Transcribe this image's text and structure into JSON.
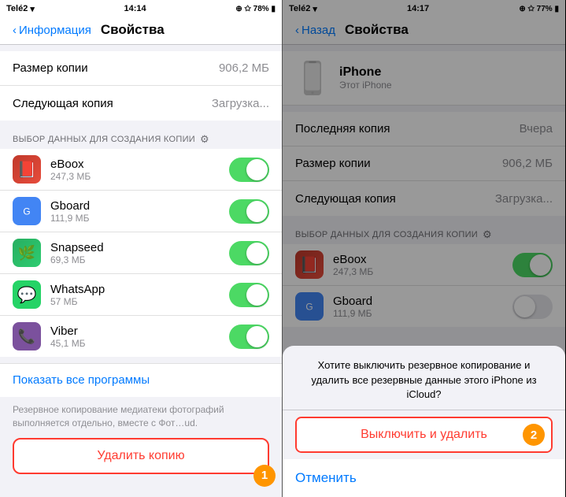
{
  "left_screen": {
    "status_bar": {
      "carrier": "Telé2",
      "time": "14:14",
      "icons_right": "⊕ ☆ 78%"
    },
    "nav": {
      "back_label": "Информация",
      "title": "Свойства"
    },
    "rows": [
      {
        "label": "Размер копии",
        "value": "906,2 МБ"
      },
      {
        "label": "Следующая копия",
        "value": "Загрузка..."
      }
    ],
    "section_header": "ВЫБОР ДАННЫХ ДЛЯ СОЗДАНИЯ КОПИИ",
    "apps": [
      {
        "name": "eBoox",
        "size": "247,3 МБ",
        "icon_type": "ebook",
        "toggle": "on"
      },
      {
        "name": "Gboard",
        "size": "111,9 МБ",
        "icon_type": "gboard",
        "toggle": "on"
      },
      {
        "name": "Snapseed",
        "size": "69,3 МБ",
        "icon_type": "snapseed",
        "toggle": "on"
      },
      {
        "name": "WhatsApp",
        "size": "57 МБ",
        "icon_type": "whatsapp",
        "toggle": "on"
      },
      {
        "name": "Viber",
        "size": "45,1 МБ",
        "icon_type": "viber",
        "toggle": "on"
      }
    ],
    "show_all": "Показать все программы",
    "footer": "Резервное копирование медиатеки фотографий выполняется отдельно, вместе с Фот…ud.",
    "delete_button": "Удалить копию",
    "badge": "1"
  },
  "right_screen": {
    "status_bar": {
      "carrier": "Telé2",
      "time": "14:17",
      "icons_right": "⊕ ☆ 77%"
    },
    "nav": {
      "back_label": "< Назад",
      "title": "Свойства"
    },
    "iphone_card": {
      "title": "iPhone",
      "subtitle": "Этот iPhone"
    },
    "rows": [
      {
        "label": "Последняя копия",
        "value": "Вчера"
      },
      {
        "label": "Размер копии",
        "value": "906,2 МБ"
      },
      {
        "label": "Следующая копия",
        "value": "Загрузка..."
      }
    ],
    "section_header": "ВЫБОР ДАННЫХ ДЛЯ СОЗДАНИЯ КОПИИ",
    "apps_visible": [
      {
        "name": "eBoox",
        "size": "247,3 МБ",
        "icon_type": "ebook",
        "toggle": "on"
      },
      {
        "name": "Gboard",
        "size": "111,9 МБ",
        "icon_type": "gboard",
        "toggle": "off"
      }
    ],
    "dialog": {
      "message": "Хотите выключить резервное копирование и удалить все резервные данные этого iPhone из iCloud?",
      "action_label": "Выключить и удалить",
      "cancel_label": "Отменить",
      "badge": "2"
    }
  }
}
